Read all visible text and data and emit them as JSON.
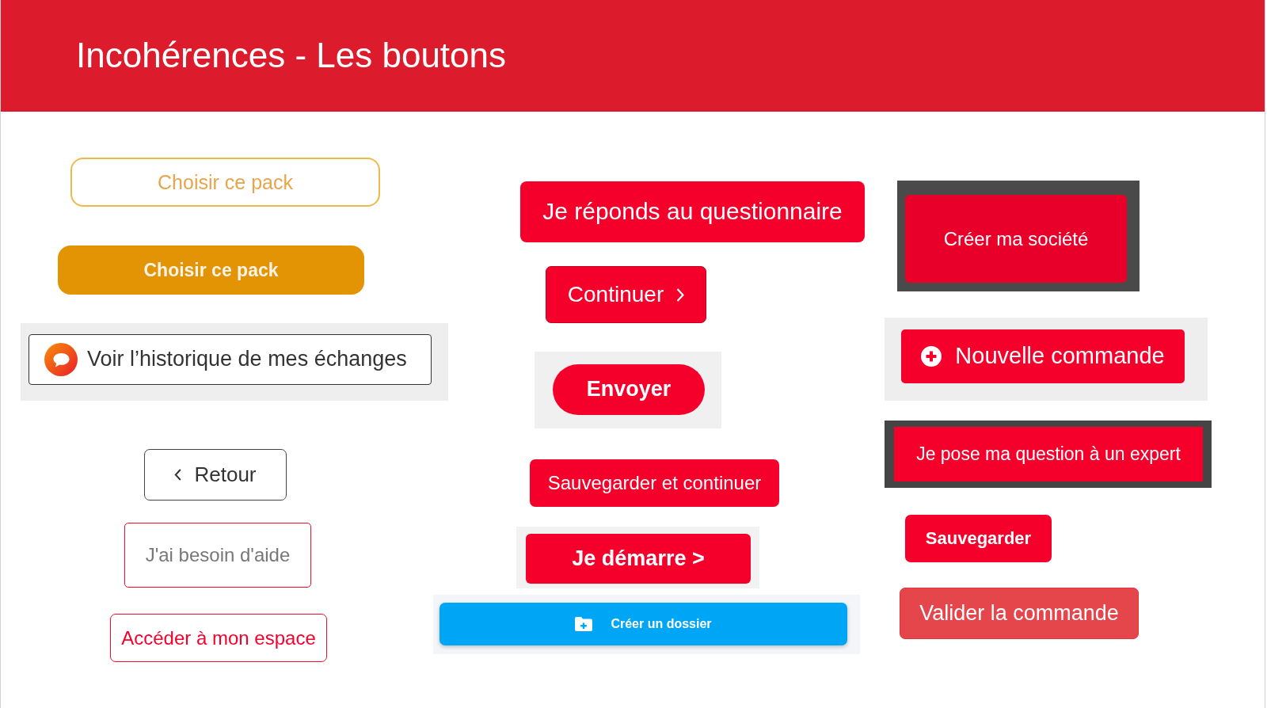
{
  "slide": {
    "title": "Incohérences - Les boutons"
  },
  "columns": [
    {
      "samples": [
        {
          "kind": "outline",
          "label": "Choisir ce pack"
        },
        {
          "kind": "filled",
          "label": "Choisir ce pack"
        },
        {
          "kind": "chat",
          "label": "Voir l’historique de mes échanges"
        },
        {
          "kind": "back",
          "label": "Retour"
        },
        {
          "kind": "help",
          "label": "J'ai besoin d'aide"
        },
        {
          "kind": "link",
          "label": "Accéder à mon espace"
        }
      ]
    },
    {
      "samples": [
        {
          "kind": "primary",
          "label": "Je réponds au questionnaire"
        },
        {
          "kind": "next",
          "label": "Continuer"
        },
        {
          "kind": "pill",
          "label": "Envoyer"
        },
        {
          "kind": "save",
          "label": "Sauvegarder et continuer"
        },
        {
          "kind": "bold",
          "label": "Je démarre >"
        },
        {
          "kind": "folder",
          "label": "Créer un dossier"
        }
      ]
    },
    {
      "samples": [
        {
          "kind": "block",
          "label": "Créer ma société"
        },
        {
          "kind": "add",
          "label": "Nouvelle commande"
        },
        {
          "kind": "flat",
          "label": "Je pose ma question à un expert"
        },
        {
          "kind": "compact",
          "label": "Sauvegarder"
        },
        {
          "kind": "soft",
          "label": "Valider la commande"
        }
      ]
    }
  ]
}
